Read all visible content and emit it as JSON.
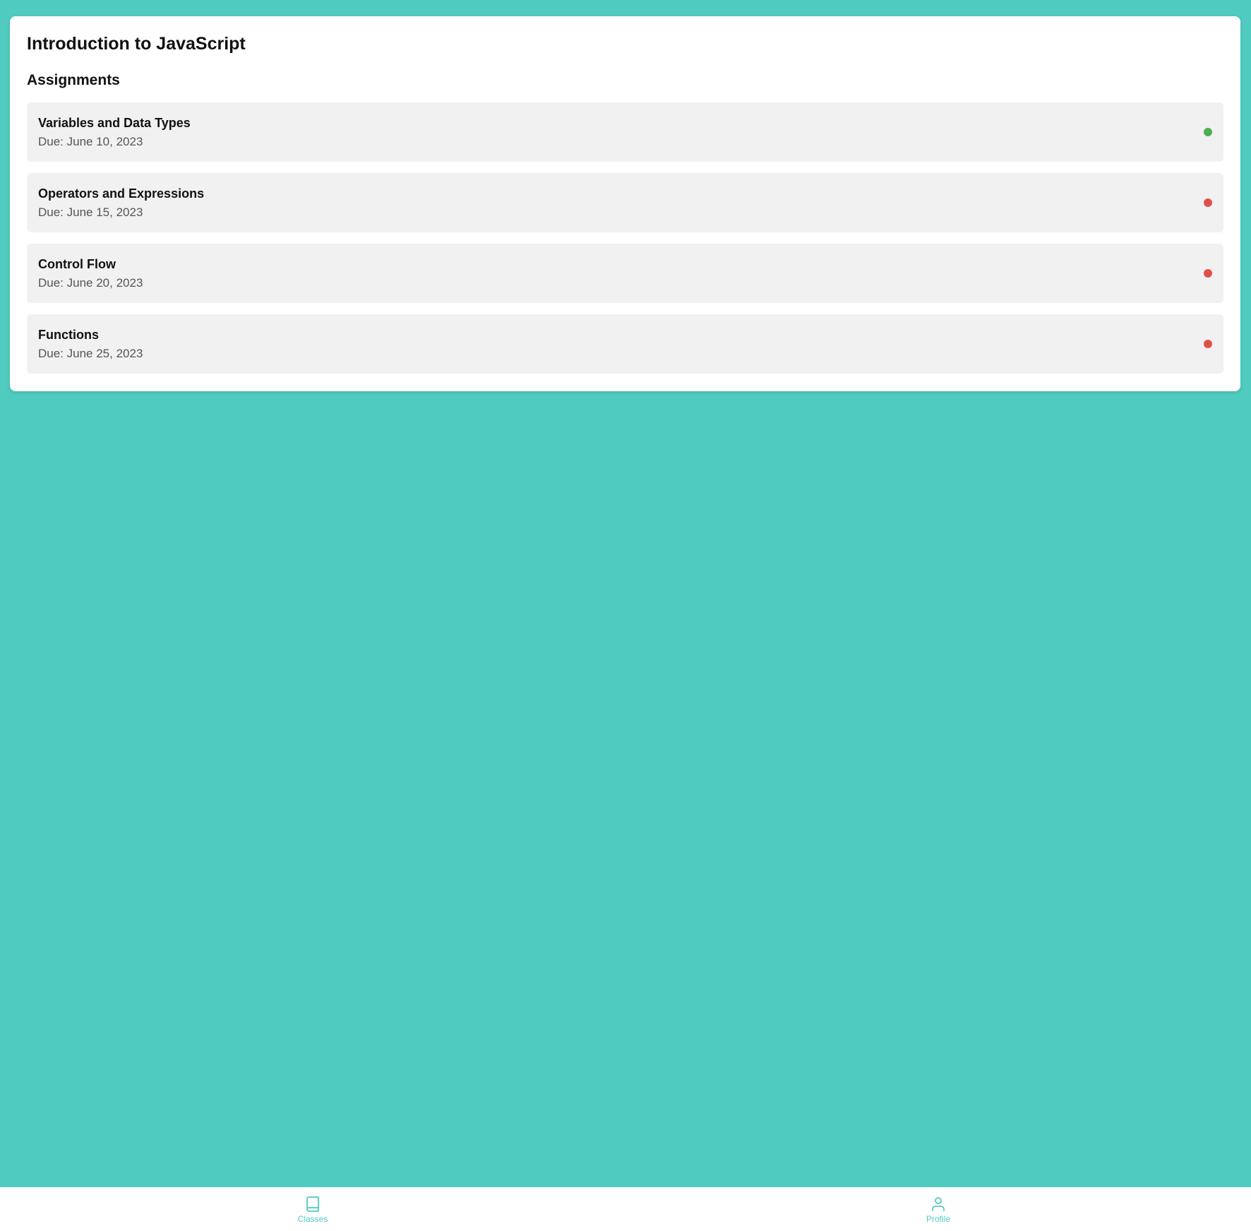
{
  "course": {
    "title": "Introduction to JavaScript"
  },
  "assignments": {
    "heading": "Assignments",
    "items": [
      {
        "name": "Variables and Data Types",
        "due": "Due: June 10, 2023",
        "status": "complete",
        "status_color": "#4caf50"
      },
      {
        "name": "Operators and Expressions",
        "due": "Due: June 15, 2023",
        "status": "incomplete",
        "status_color": "#e0504a"
      },
      {
        "name": "Control Flow",
        "due": "Due: June 20, 2023",
        "status": "incomplete",
        "status_color": "#e0504a"
      },
      {
        "name": "Functions",
        "due": "Due: June 25, 2023",
        "status": "incomplete",
        "status_color": "#e0504a"
      }
    ]
  },
  "nav": {
    "items": [
      {
        "label": "Classes",
        "icon": "book-icon"
      },
      {
        "label": "Profile",
        "icon": "user-icon"
      }
    ]
  },
  "colors": {
    "background": "#50cbbf",
    "accent": "#50cbbf",
    "card": "#ffffff",
    "item_background": "#f1f1f1"
  }
}
